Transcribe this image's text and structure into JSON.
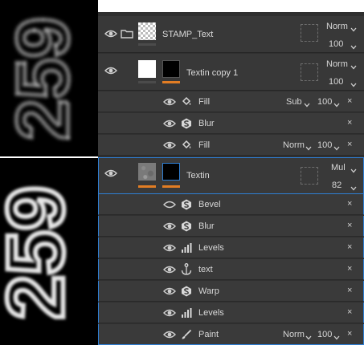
{
  "canvas": {
    "top_text": "259",
    "bottom_text": "259"
  },
  "layers": [
    {
      "name": "STAMP_Text",
      "blend": "Norm",
      "opacity": "100"
    },
    {
      "name": "Textin copy 1",
      "blend": "Norm",
      "opacity": "100",
      "effects": [
        {
          "name": "Fill",
          "icon": "paint-bucket-icon",
          "blend": "Sub",
          "opacity": "100"
        },
        {
          "name": "Blur",
          "icon": "s-effect-icon"
        },
        {
          "name": "Fill",
          "icon": "paint-bucket-icon",
          "blend": "Norm",
          "opacity": "100"
        }
      ]
    },
    {
      "name": "Textin",
      "blend": "Mul",
      "opacity": "82",
      "effects": [
        {
          "name": "Bevel",
          "icon": "s-effect-icon"
        },
        {
          "name": "Blur",
          "icon": "s-effect-icon"
        },
        {
          "name": "Levels",
          "icon": "levels-icon"
        },
        {
          "name": "text",
          "icon": "anchor-icon"
        },
        {
          "name": "Warp",
          "icon": "s-effect-icon"
        },
        {
          "name": "Levels",
          "icon": "levels-icon"
        },
        {
          "name": "Paint",
          "icon": "brush-icon",
          "blend": "Norm",
          "opacity": "100"
        }
      ]
    }
  ],
  "close_glyph": "×",
  "accent_color": "#2f7fd4",
  "mask_bar_color": "#e27d24"
}
